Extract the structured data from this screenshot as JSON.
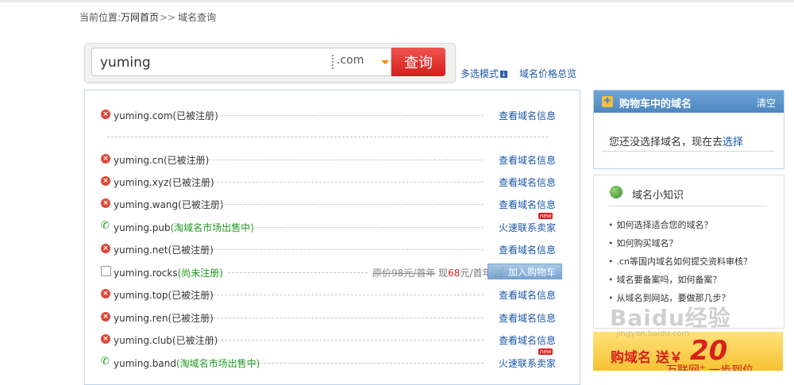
{
  "breadcrumb": {
    "prefix": "当前位置:",
    "home": "万网首页",
    "sep": ">>",
    "current": "域名查询"
  },
  "search": {
    "value": "yuming",
    "tld": ".com",
    "button": "查询"
  },
  "links": {
    "multi_mode": "多选模式",
    "price_overview": "域名价格总览"
  },
  "results": [
    {
      "domain": "yuming.com",
      "status": "(已被注册)",
      "status_kind": "taken",
      "action": "查看域名信息"
    },
    {
      "domain": "yuming.cn",
      "status": "(已被注册)",
      "status_kind": "taken",
      "action": "查看域名信息"
    },
    {
      "domain": "yuming.xyz",
      "status": "(已被注册)",
      "status_kind": "taken",
      "action": "查看域名信息"
    },
    {
      "domain": "yuming.wang",
      "status": "(已被注册)",
      "status_kind": "taken",
      "action": "查看域名信息"
    },
    {
      "domain": "yuming.pub",
      "status": "(淘域名市场出售中)",
      "status_kind": "market",
      "action": "火速联系卖家",
      "badge": "new"
    },
    {
      "domain": "yuming.net",
      "status": "(已被注册)",
      "status_kind": "taken",
      "action": "查看域名信息"
    },
    {
      "domain": "yuming.rocks",
      "status": "(尚未注册)",
      "status_kind": "available",
      "price_old": "原价98元/首年",
      "price_now_label": "现",
      "price_now": "68",
      "price_now_unit": "元/首年",
      "action": "加入购物车"
    },
    {
      "domain": "yuming.top",
      "status": "(已被注册)",
      "status_kind": "taken",
      "action": "查看域名信息"
    },
    {
      "domain": "yuming.ren",
      "status": "(已被注册)",
      "status_kind": "taken",
      "action": "查看域名信息"
    },
    {
      "domain": "yuming.club",
      "status": "(已被注册)",
      "status_kind": "taken",
      "action": "查看域名信息"
    },
    {
      "domain": "yuming.band",
      "status": "(淘域名市场出售中)",
      "status_kind": "market",
      "action": "火速联系卖家",
      "badge": "new"
    }
  ],
  "cart": {
    "title": "购物车中的域名",
    "clear": "清空",
    "empty_text": "您还没选择域名，现在去",
    "empty_link": "选择"
  },
  "tips": {
    "title": "域名小知识",
    "items": [
      "如何选择适合您的域名？",
      "如何购买域名？",
      ".cn等国内域名如何提交资料审核？",
      "域名要备案吗，如何备案？",
      "从域名到网站，要做那几步？"
    ]
  },
  "promo": {
    "line1": "购域名 送￥",
    "amount": "20",
    "line2": "万联网",
    "line2_sup": "+",
    "line2_rest": " 一步到位"
  },
  "watermark": {
    "main": "Baidu经验",
    "sub": "jingyan.baidu.com"
  }
}
